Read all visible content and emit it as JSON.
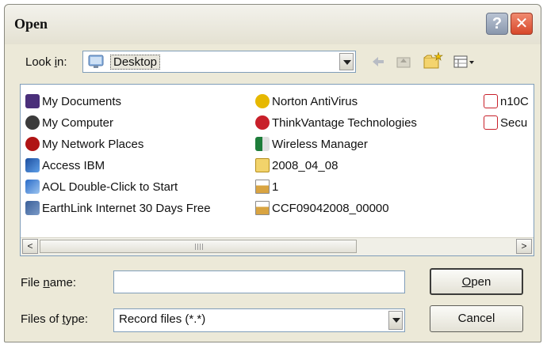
{
  "dialog": {
    "title": "Open",
    "help_symbol": "?",
    "close_symbol": "✕"
  },
  "look_in": {
    "label_prefix": "Look ",
    "label_access": "i",
    "label_suffix": "n:",
    "value": "Desktop",
    "icon": "desktop-icon"
  },
  "toolbar": {
    "back_icon": "back-arrow-icon",
    "up_icon": "up-folder-icon",
    "new_folder_icon": "new-folder-icon",
    "views_icon": "views-menu-icon"
  },
  "files": {
    "col1": [
      {
        "name": "My Documents",
        "icon": "my-documents-icon",
        "color": "#4a2f7a"
      },
      {
        "name": "My Computer",
        "icon": "my-computer-icon",
        "color": "#3b3b3b"
      },
      {
        "name": "My Network Places",
        "icon": "network-places-icon",
        "color": "#b01515"
      },
      {
        "name": "Access IBM",
        "icon": "access-ibm-icon",
        "color": "#1d4fa0"
      },
      {
        "name": "AOL Double-Click to Start",
        "icon": "aol-icon",
        "color": "#2a6cc9"
      },
      {
        "name": "EarthLink Internet 30 Days Free",
        "icon": "earthlink-icon",
        "color": "#3a5f98"
      }
    ],
    "col2": [
      {
        "name": "Norton AntiVirus",
        "icon": "norton-icon",
        "color": "#e6b800"
      },
      {
        "name": "ThinkVantage Technologies",
        "icon": "thinkvantage-icon",
        "color": "#c8202a"
      },
      {
        "name": "Wireless Manager",
        "icon": "wireless-manager-icon",
        "color": "#1e7d3a"
      },
      {
        "name": "2008_04_08",
        "icon": "folder-icon",
        "color": "#f2d36b"
      },
      {
        "name": "1",
        "icon": "file-icon",
        "color": "#d9a441"
      },
      {
        "name": "CCF09042008_00000",
        "icon": "file-icon",
        "color": "#d9a441"
      }
    ],
    "col3": [
      {
        "name": "n10C",
        "icon": "pdf-icon",
        "color": "#c8202a"
      },
      {
        "name": "Secu",
        "icon": "pdf-icon",
        "color": "#c8202a"
      }
    ]
  },
  "scrollbar": {
    "left_arrow": "<",
    "right_arrow": ">"
  },
  "file_name": {
    "label_prefix": "File ",
    "label_access": "n",
    "label_suffix": "ame:",
    "value": ""
  },
  "file_type": {
    "label_prefix": "Files of ",
    "label_access": "t",
    "label_suffix": "ype:",
    "value": "Record files (*.*)"
  },
  "buttons": {
    "open_access": "O",
    "open_rest": "pen",
    "cancel": "Cancel"
  }
}
